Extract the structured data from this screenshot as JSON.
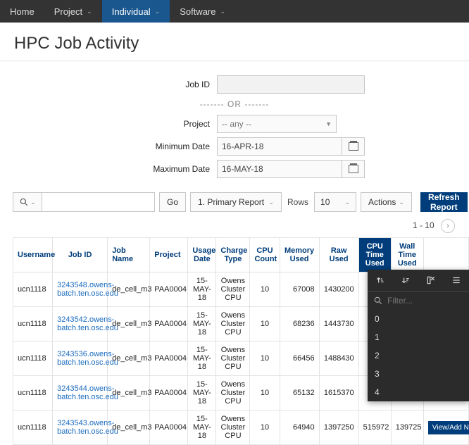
{
  "nav": {
    "items": [
      {
        "label": "Home",
        "active": false,
        "dropdown": false
      },
      {
        "label": "Project",
        "active": false,
        "dropdown": true
      },
      {
        "label": "Individual",
        "active": true,
        "dropdown": true
      },
      {
        "label": "Software",
        "active": false,
        "dropdown": true
      }
    ]
  },
  "page_title": "HPC Job Activity",
  "filters": {
    "job_id_label": "Job ID",
    "job_id_value": "",
    "or_text": "-------  OR  -------",
    "project_label": "Project",
    "project_value": "--  any  --",
    "min_date_label": "Minimum Date",
    "min_date_value": "16-APR-18",
    "max_date_label": "Maximum Date",
    "max_date_value": "16-MAY-18"
  },
  "toolbar": {
    "go_label": "Go",
    "report_select": "1. Primary Report",
    "rows_label": "Rows",
    "rows_value": "10",
    "actions_label": "Actions",
    "refresh_label": "Refresh Report"
  },
  "pagination": {
    "text": "1 - 10"
  },
  "columns": {
    "username": "Username",
    "job_id": "Job ID",
    "job_name": "Job Name",
    "project": "Project",
    "usage_date": "Usage Date",
    "charge_type": "Charge Type",
    "cpu_count": "CPU Count",
    "memory_used": "Memory Used",
    "raw_used": "Raw Used",
    "cpu_time_used": "CPU Time Used",
    "wall_time_used": "Wall Time Used",
    "action": ""
  },
  "popup": {
    "filter_placeholder": "Filter...",
    "items": [
      "0",
      "1",
      "2",
      "3",
      "4"
    ]
  },
  "rows": [
    {
      "username": "ucn1118",
      "job_id": "3243548.owens-batch.ten.osc.edu",
      "job_name": "de_cell_m3",
      "project": "PAA0004",
      "usage_date": "15-MAY-18",
      "charge_type": "Owens Cluster CPU",
      "cpu_count": "10",
      "memory_used": "67008",
      "raw_used": "1430200",
      "cpu_time": "",
      "wall_time": "",
      "action": ""
    },
    {
      "username": "ucn1118",
      "job_id": "3243542.owens-batch.ten.osc.edu",
      "job_name": "de_cell_m3",
      "project": "PAA0004",
      "usage_date": "15-MAY-18",
      "charge_type": "Owens Cluster CPU",
      "cpu_count": "10",
      "memory_used": "68236",
      "raw_used": "1443730",
      "cpu_time": "",
      "wall_time": "",
      "action": ""
    },
    {
      "username": "ucn1118",
      "job_id": "3243536.owens-batch.ten.osc.edu",
      "job_name": "de_cell_m3",
      "project": "PAA0004",
      "usage_date": "15-MAY-18",
      "charge_type": "Owens Cluster CPU",
      "cpu_count": "10",
      "memory_used": "66456",
      "raw_used": "1488430",
      "cpu_time": "",
      "wall_time": "",
      "action": ""
    },
    {
      "username": "ucn1118",
      "job_id": "3243544.owens-batch.ten.osc.edu",
      "job_name": "de_cell_m3",
      "project": "PAA0004",
      "usage_date": "15-MAY-18",
      "charge_type": "Owens Cluster CPU",
      "cpu_count": "10",
      "memory_used": "65132",
      "raw_used": "1615370",
      "cpu_time": "",
      "wall_time": "",
      "action": ""
    },
    {
      "username": "ucn1118",
      "job_id": "3243543.owens-batch.ten.osc.edu",
      "job_name": "de_cell_m3",
      "project": "PAA0004",
      "usage_date": "15-MAY-18",
      "charge_type": "Owens Cluster CPU",
      "cpu_count": "10",
      "memory_used": "64940",
      "raw_used": "1397250",
      "cpu_time": "515972",
      "wall_time": "139725",
      "action": "View/Add N"
    }
  ]
}
